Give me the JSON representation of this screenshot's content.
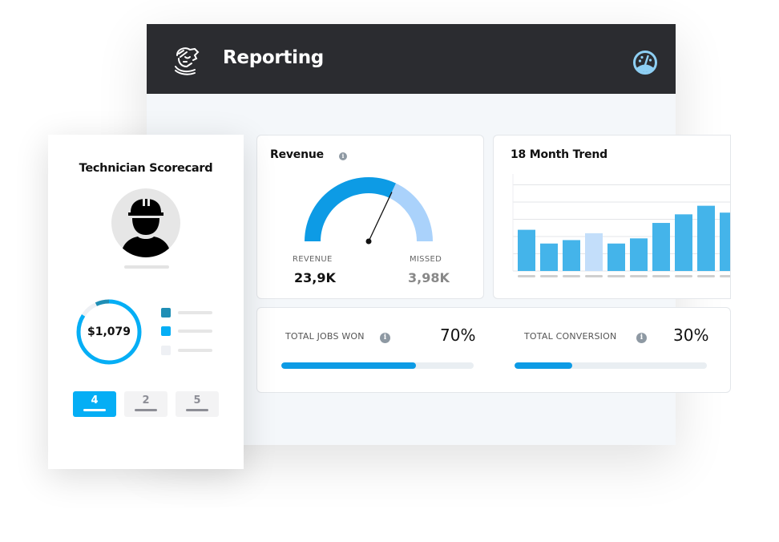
{
  "header": {
    "title": "Reporting",
    "logo_icon": "knight-helmet-logo",
    "right_icon": "dashboard-gauge-icon",
    "accent_icon_color": "#8ecff3"
  },
  "scorecard": {
    "title": "Technician Scorecard",
    "avatar_icon": "technician-hardhat-icon",
    "donut_value": "$1,079",
    "donut_segments": [
      {
        "name": "segment-1",
        "fraction": 0.07,
        "color": "#1f8eb5"
      },
      {
        "name": "segment-2",
        "fraction": 0.09,
        "color": "#eef0f4"
      },
      {
        "name": "segment-3",
        "fraction": 0.84,
        "color": "#05aef5"
      }
    ],
    "legend": [
      {
        "color": "#1f8eb5"
      },
      {
        "color": "#05aef5"
      },
      {
        "color": "#eef0f4"
      }
    ],
    "tabs": [
      {
        "label": "4",
        "active": true
      },
      {
        "label": "2",
        "active": false
      },
      {
        "label": "5",
        "active": false
      }
    ]
  },
  "revenue": {
    "title": "Revenue",
    "gauge_fraction": 0.64,
    "revenue_label": "REVENUE",
    "revenue_value": "23,9K",
    "missed_label": "MISSED",
    "missed_value": "3,98K",
    "colors": {
      "revenue": "#0d9be5",
      "missed": "#aad2fb"
    }
  },
  "stats": [
    {
      "label": "TOTAL JOBS WON",
      "value": "70%",
      "fraction": 0.7
    },
    {
      "label": "TOTAL CONVERSION",
      "value": "30%",
      "fraction": 0.3
    }
  ],
  "chart_data": {
    "type": "bar",
    "title": "18 Month Trend",
    "categories": [
      "",
      "",
      "",
      "",
      "",
      "",
      "",
      "",
      "",
      ""
    ],
    "values": [
      2.4,
      1.6,
      1.8,
      2.2,
      1.6,
      1.9,
      2.8,
      3.3,
      3.8,
      3.4
    ],
    "highlighted_index": 3,
    "ylim": [
      0,
      5
    ],
    "grid": true,
    "xlabel": "",
    "ylabel": "",
    "colors": {
      "bar": "#44b4ea",
      "highlight": "#c3defa"
    }
  }
}
